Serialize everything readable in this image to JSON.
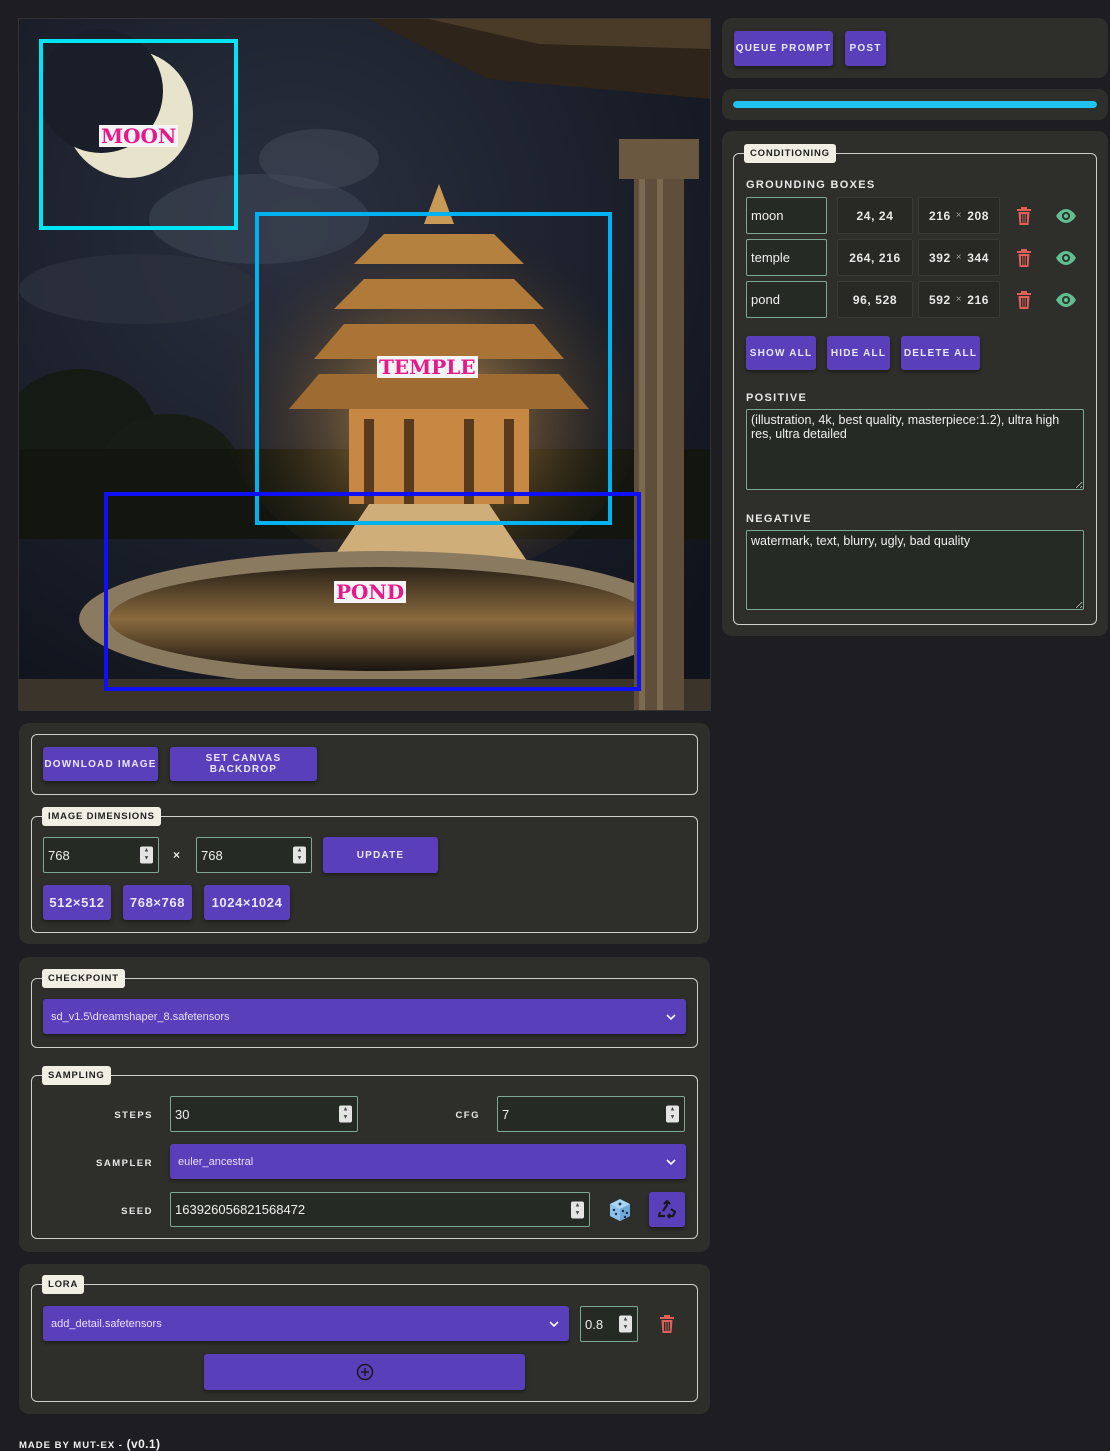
{
  "canvas": {
    "boxes": [
      {
        "label": "MOON",
        "color": "#00e5f5"
      },
      {
        "label": "TEMPLE",
        "color": "#00b2f0"
      },
      {
        "label": "POND",
        "color": "#1010f5"
      }
    ]
  },
  "top_actions": {
    "queue_prompt": "QUEUE PROMPT",
    "post": "POST"
  },
  "progress": {
    "fraction": 1.0,
    "color": "#1fc3ee"
  },
  "conditioning": {
    "legend": "CONDITIONING",
    "grounding_label": "GROUNDING BOXES",
    "rows": [
      {
        "name": "moon",
        "pos": "24, 24",
        "w": "216",
        "h": "208"
      },
      {
        "name": "temple",
        "pos": "264, 216",
        "w": "392",
        "h": "344"
      },
      {
        "name": "pond",
        "pos": "96, 528",
        "w": "592",
        "h": "216"
      }
    ],
    "size_sep": "×",
    "show_all": "SHOW ALL",
    "hide_all": "HIDE ALL",
    "delete_all": "DELETE ALL",
    "positive_label": "POSITIVE",
    "positive": "(illustration, 4k, best quality, masterpiece:1.2), ultra high res, ultra detailed",
    "negative_label": "NEGATIVE",
    "negative": "watermark, text, blurry, ugly, bad quality"
  },
  "image_actions": {
    "download": "DOWNLOAD IMAGE",
    "backdrop": "SET CANVAS BACKDROP"
  },
  "dimensions": {
    "legend": "IMAGE DIMENSIONS",
    "width": "768",
    "height": "768",
    "sep": "×",
    "update": "UPDATE",
    "presets": [
      "512×512",
      "768×768",
      "1024×1024"
    ]
  },
  "checkpoint": {
    "legend": "CHECKPOINT",
    "value": "sd_v1.5\\dreamshaper_8.safetensors"
  },
  "sampling": {
    "legend": "SAMPLING",
    "steps_label": "STEPS",
    "steps": "30",
    "cfg_label": "CFG",
    "cfg": "7",
    "sampler_label": "SAMPLER",
    "sampler": "euler_ancestral",
    "seed_label": "SEED",
    "seed": "163926056821568472"
  },
  "lora": {
    "legend": "LORA",
    "value": "add_detail.safetensors",
    "strength": "0.8"
  },
  "footer": {
    "made_by": "MADE BY MUT-EX -",
    "version": "(v0.1)"
  },
  "colors": {
    "accent": "#5a3fbb",
    "trash": "#e0605a",
    "eye": "#5fbf90"
  }
}
